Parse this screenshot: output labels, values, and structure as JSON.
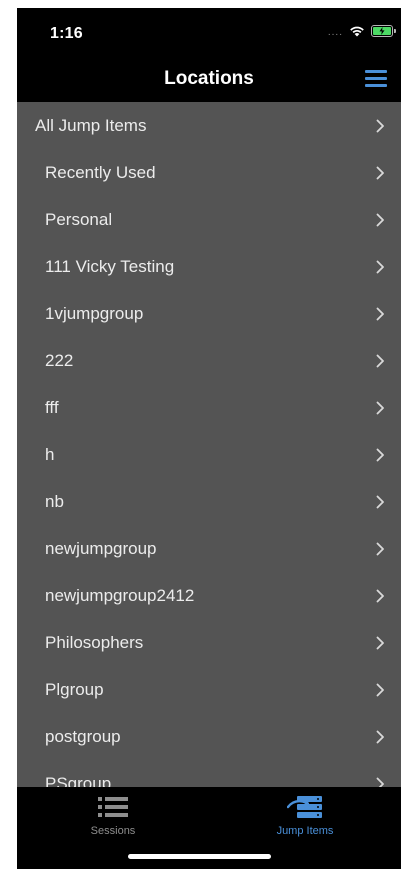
{
  "status": {
    "time": "1:16",
    "signal_text": "...."
  },
  "nav": {
    "title": "Locations"
  },
  "list": {
    "all_items": "All Jump Items",
    "groups": [
      "Recently Used",
      "Personal",
      "111 Vicky Testing",
      "1vjumpgroup",
      "222",
      "fff",
      "h",
      "nb",
      "newjumpgroup",
      "newjumpgroup2412",
      "Philosophers",
      "Plgroup",
      "postgroup",
      "PSgroup"
    ]
  },
  "tabs": {
    "sessions": "Sessions",
    "jump_items": "Jump Items"
  },
  "colors": {
    "accent": "#4a90d9",
    "list_background": "#545454",
    "bar_background": "#000000",
    "battery": "#4cd964"
  }
}
